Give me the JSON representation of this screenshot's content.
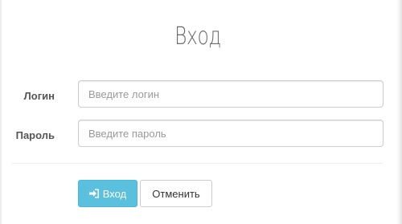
{
  "form": {
    "title": "Вход",
    "login_label": "Логин",
    "login_placeholder": "Введите логин",
    "login_value": "",
    "password_label": "Пароль",
    "password_placeholder": "Введите пароль",
    "password_value": ""
  },
  "actions": {
    "submit_label": "Вход",
    "submit_icon": "sign-in-icon",
    "cancel_label": "Отменить"
  },
  "colors": {
    "primary": "#5bc0de",
    "primary_border": "#46b8da",
    "label": "#555555",
    "title": "#6c6c6c"
  }
}
